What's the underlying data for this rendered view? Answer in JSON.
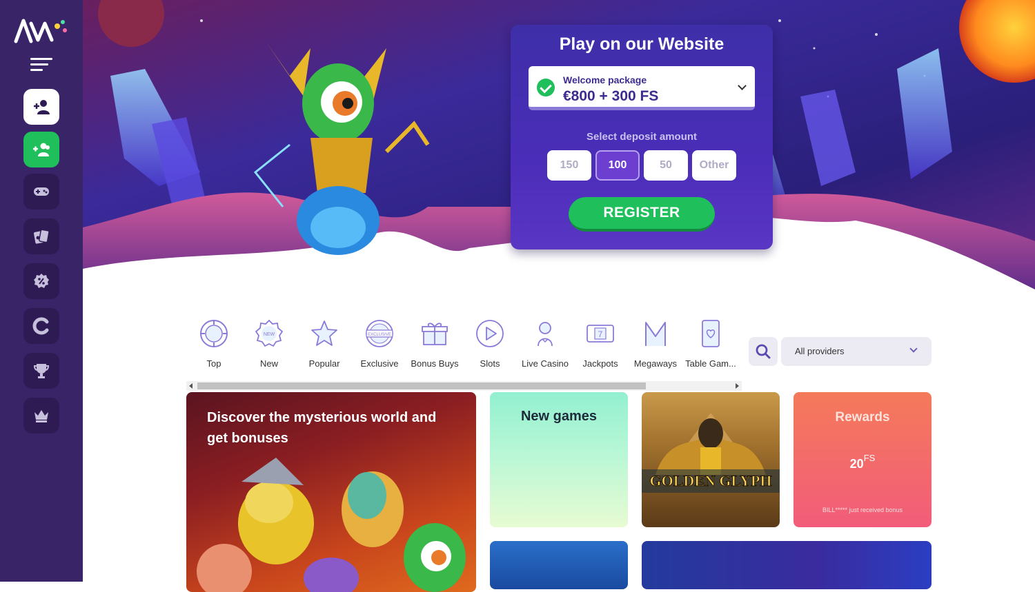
{
  "sidebar": {
    "logo": "logo",
    "items": [
      {
        "name": "user-plus-icon"
      },
      {
        "name": "users-icon"
      },
      {
        "name": "gamepad-icon"
      },
      {
        "name": "cards-icon"
      },
      {
        "name": "percent-badge-icon"
      },
      {
        "name": "loading-icon"
      },
      {
        "name": "trophy-icon"
      },
      {
        "name": "crown-icon"
      }
    ]
  },
  "registration": {
    "title": "Play on our Website",
    "welcome_label": "Welcome package",
    "welcome_value": "€800 + 300 FS",
    "deposit_label": "Select deposit amount",
    "amounts": [
      "150",
      "100",
      "50",
      "Other"
    ],
    "selected_amount": "100",
    "register_label": "REGISTER"
  },
  "categories": [
    {
      "label": "Top",
      "icon": "top-icon"
    },
    {
      "label": "New",
      "icon": "new-icon"
    },
    {
      "label": "Popular",
      "icon": "star-icon"
    },
    {
      "label": "Exclusive",
      "icon": "exclusive-icon"
    },
    {
      "label": "Bonus Buys",
      "icon": "gift-icon"
    },
    {
      "label": "Slots",
      "icon": "play-icon"
    },
    {
      "label": "Live Casino",
      "icon": "dealer-icon"
    },
    {
      "label": "Jackpots",
      "icon": "jackpot-icon"
    },
    {
      "label": "Megaways",
      "icon": "megaways-icon"
    },
    {
      "label": "Table Gam...",
      "icon": "card-icon"
    }
  ],
  "filters": {
    "providers_label": "All providers"
  },
  "tiles": {
    "promo_title": "Discover the mysterious world and get bonuses",
    "new_games": "New games",
    "golden_glyph": "GOLDEN GLYPH",
    "rewards_title": "Rewards",
    "rewards_amount": "20",
    "rewards_unit": "FS",
    "rewards_note": "BILL***** just received bonus"
  },
  "colors": {
    "sidebar": "#3a2468",
    "accent_green": "#1fbf5b",
    "card_purple": "#4a2db8",
    "selected_amount": "#6d3fd0"
  }
}
